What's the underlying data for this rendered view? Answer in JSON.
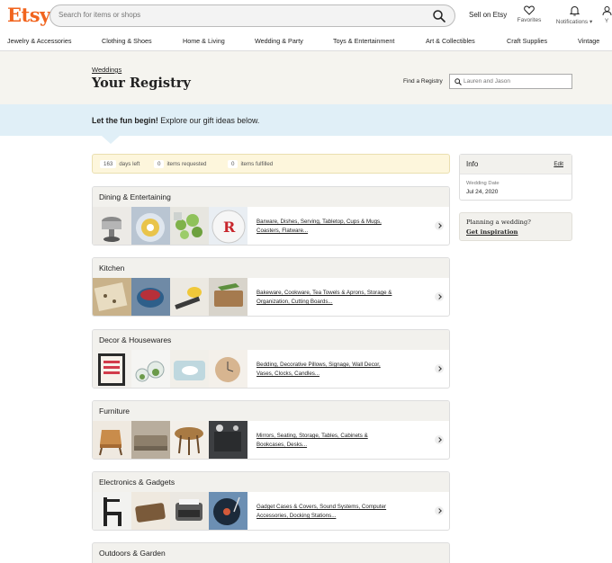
{
  "header": {
    "logo": "Etsy",
    "search_placeholder": "Search for items or shops",
    "sell_label": "Sell on Etsy",
    "favorites_label": "Favorites",
    "notifications_label": "Notifications ▾",
    "partial_label": "Y"
  },
  "categories": [
    "Jewelry & Accessories",
    "Clothing & Shoes",
    "Home & Living",
    "Wedding & Party",
    "Toys & Entertainment",
    "Art & Collectibles",
    "Craft Supplies",
    "Vintage"
  ],
  "registry": {
    "breadcrumb": "Weddings",
    "title": "Your Registry",
    "find_label": "Find a Registry",
    "find_placeholder": "Lauren and Jason"
  },
  "promo": {
    "bold": "Let the fun begin!",
    "rest": " Explore our gift ideas below."
  },
  "stats": {
    "days_left_value": "163",
    "days_left_label": "days left",
    "requested_value": "0",
    "requested_label": "items requested",
    "fulfilled_value": "0",
    "fulfilled_label": "items fulfilled"
  },
  "sections": [
    {
      "title": "Dining & Entertaining",
      "links": "Barware, Dishes, Serving, Tabletop, Cups & Mugs, Coasters, Flatware..."
    },
    {
      "title": "Kitchen",
      "links": "Bakeware, Cookware, Tea Towels & Aprons, Storage & Organization, Cutting Boards..."
    },
    {
      "title": "Decor & Housewares",
      "links": "Bedding, Decorative Pillows, Signage, Wall Decor, Vases, Clocks, Candles..."
    },
    {
      "title": "Furniture",
      "links": "Mirrors, Seating, Storage, Tables, Cabinets & Bookcases, Desks..."
    },
    {
      "title": "Electronics & Gadgets",
      "links": "Gadget Cases & Covers, Sound Systems, Computer Accessories, Docking Stations..."
    },
    {
      "title": "Outdoors & Garden",
      "links": ""
    }
  ],
  "info": {
    "title": "Info",
    "edit_label": "Edit",
    "date_label": "Wedding Date",
    "date_value": "Jul 24, 2020"
  },
  "planning": {
    "question": "Planning a wedding?",
    "link": "Get inspiration"
  }
}
